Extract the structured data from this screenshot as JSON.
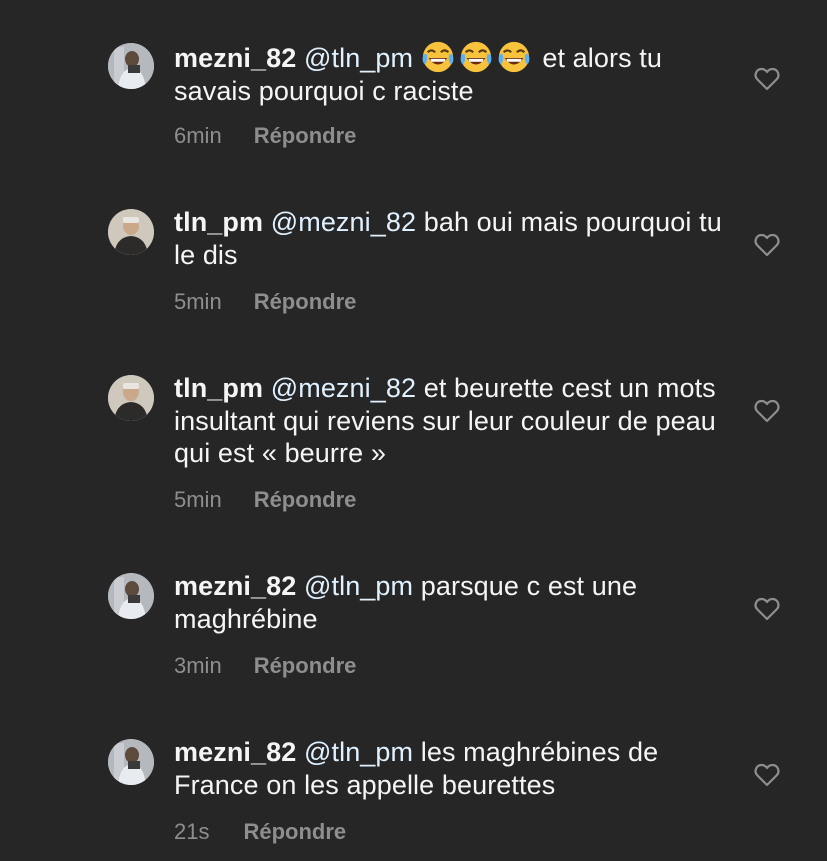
{
  "comments": [
    {
      "username": "mezni_82",
      "mention": "@tln_pm",
      "emoji": "laughing-tears",
      "emoji_count": 3,
      "text": "et alors tu savais pourquoi c raciste",
      "time": "6min",
      "reply_label": "Répondre"
    },
    {
      "username": "tln_pm",
      "mention": "@mezni_82",
      "text": "bah oui mais pourquoi tu le dis",
      "time": "5min",
      "reply_label": "Répondre"
    },
    {
      "username": "tln_pm",
      "mention": "@mezni_82",
      "text": "et beurette cest un mots insultant qui reviens sur leur couleur de peau qui est « beurre »",
      "time": "5min",
      "reply_label": "Répondre"
    },
    {
      "username": "mezni_82",
      "mention": "@tln_pm",
      "text": "parsque c est une maghrébine",
      "time": "3min",
      "reply_label": "Répondre"
    },
    {
      "username": "mezni_82",
      "mention": "@tln_pm",
      "text": "les maghrébines de France on les appelle beurettes",
      "time": "21s",
      "reply_label": "Répondre"
    }
  ],
  "colors": {
    "background": "#262626",
    "text": "#f5f5f5",
    "mention": "#e0f1ff",
    "secondary": "#8e8e8e"
  },
  "icons": {
    "like": "heart-outline-icon",
    "emoji": "face-with-tears-of-joy"
  }
}
